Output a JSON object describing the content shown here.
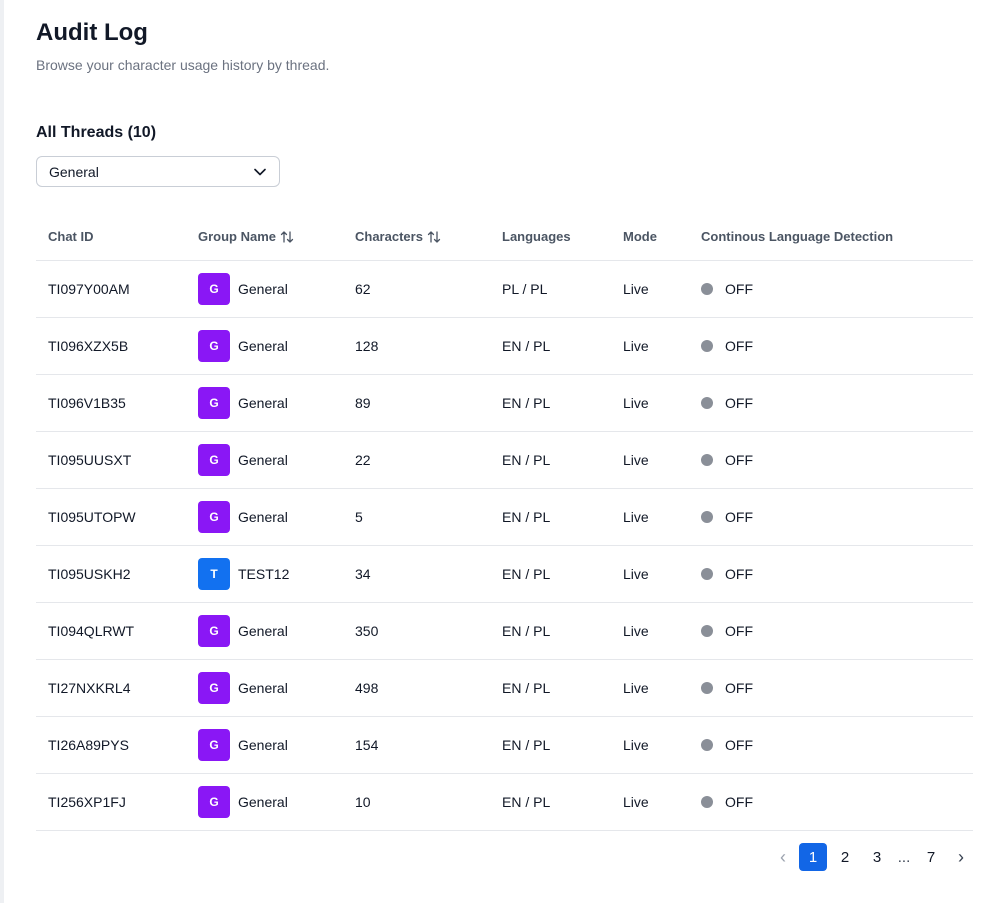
{
  "header": {
    "title": "Audit Log",
    "subtitle": "Browse your character usage history by thread."
  },
  "threads": {
    "section_title": "All Threads (10)",
    "filter": {
      "selected": "General"
    }
  },
  "table": {
    "columns": {
      "chat_id": "Chat ID",
      "group_name": "Group Name",
      "characters": "Characters",
      "languages": "Languages",
      "mode": "Mode",
      "cld": "Continous Language Detection"
    },
    "rows": [
      {
        "chat_id": "TI097Y00AM",
        "avatar": "G",
        "avatar_color": "#8a17f5",
        "group": "General",
        "characters": "62",
        "languages": "PL / PL",
        "mode": "Live",
        "cld": "OFF"
      },
      {
        "chat_id": "TI096XZX5B",
        "avatar": "G",
        "avatar_color": "#8a17f5",
        "group": "General",
        "characters": "128",
        "languages": "EN / PL",
        "mode": "Live",
        "cld": "OFF"
      },
      {
        "chat_id": "TI096V1B35",
        "avatar": "G",
        "avatar_color": "#8a17f5",
        "group": "General",
        "characters": "89",
        "languages": "EN / PL",
        "mode": "Live",
        "cld": "OFF"
      },
      {
        "chat_id": "TI095UUSXT",
        "avatar": "G",
        "avatar_color": "#8a17f5",
        "group": "General",
        "characters": "22",
        "languages": "EN / PL",
        "mode": "Live",
        "cld": "OFF"
      },
      {
        "chat_id": "TI095UTOPW",
        "avatar": "G",
        "avatar_color": "#8a17f5",
        "group": "General",
        "characters": "5",
        "languages": "EN / PL",
        "mode": "Live",
        "cld": "OFF"
      },
      {
        "chat_id": "TI095USKH2",
        "avatar": "T",
        "avatar_color": "#1271f0",
        "group": "TEST12",
        "characters": "34",
        "languages": "EN / PL",
        "mode": "Live",
        "cld": "OFF"
      },
      {
        "chat_id": "TI094QLRWT",
        "avatar": "G",
        "avatar_color": "#8a17f5",
        "group": "General",
        "characters": "350",
        "languages": "EN / PL",
        "mode": "Live",
        "cld": "OFF"
      },
      {
        "chat_id": "TI27NXKRL4",
        "avatar": "G",
        "avatar_color": "#8a17f5",
        "group": "General",
        "characters": "498",
        "languages": "EN / PL",
        "mode": "Live",
        "cld": "OFF"
      },
      {
        "chat_id": "TI26A89PYS",
        "avatar": "G",
        "avatar_color": "#8a17f5",
        "group": "General",
        "characters": "154",
        "languages": "EN / PL",
        "mode": "Live",
        "cld": "OFF"
      },
      {
        "chat_id": "TI256XP1FJ",
        "avatar": "G",
        "avatar_color": "#8a17f5",
        "group": "General",
        "characters": "10",
        "languages": "EN / PL",
        "mode": "Live",
        "cld": "OFF"
      }
    ]
  },
  "pagination": {
    "prev": "‹",
    "pages": [
      "1",
      "2",
      "3"
    ],
    "ellipsis": "...",
    "last": "7",
    "next": "›",
    "current": "1"
  },
  "colors": {
    "active_page": "#1266e6",
    "status_off": "#8a8f98"
  },
  "icons": {
    "select": "chevron-down-icon",
    "sort": "sort-icon",
    "status": "status-dot-icon"
  }
}
